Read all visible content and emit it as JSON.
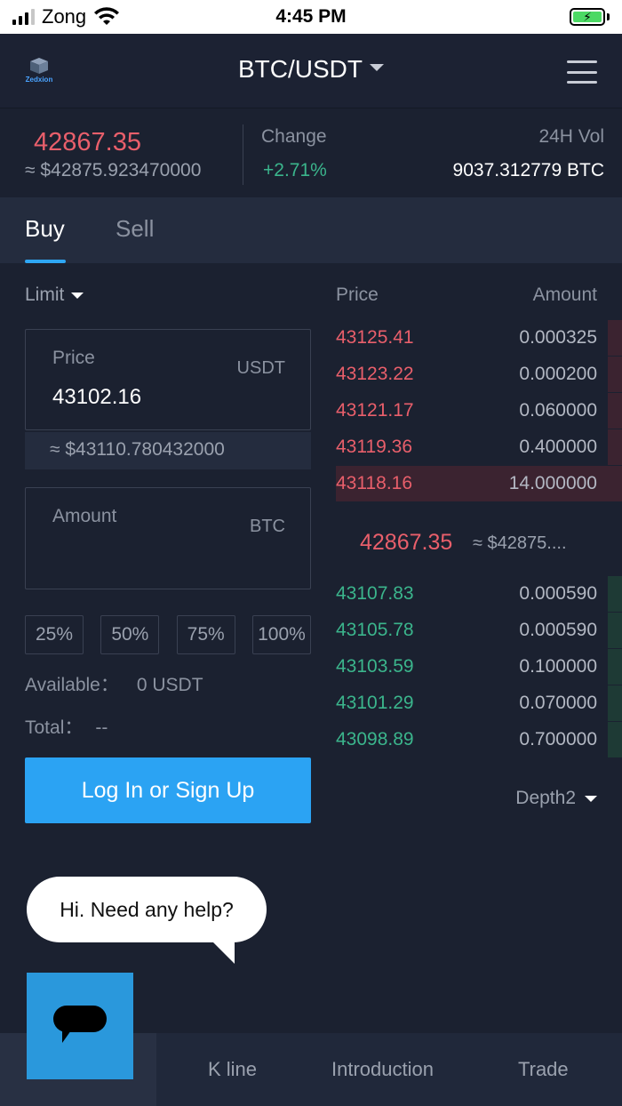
{
  "status_bar": {
    "carrier": "Zong",
    "time": "4:45 PM"
  },
  "header": {
    "logo_text": "Zedxion",
    "pair": "BTC/USDT"
  },
  "ticker": {
    "last_price": "42867.35",
    "last_price_usd": "≈ $42875.923470000",
    "change_label": "Change",
    "change_value": "+2.71%",
    "vol_label": "24H Vol",
    "vol_value": "9037.312779 BTC"
  },
  "tabs": {
    "buy": "Buy",
    "sell": "Sell"
  },
  "order_form": {
    "order_type": "Limit",
    "price_label": "Price",
    "price_unit": "USDT",
    "price_value": "43102.16",
    "price_usd": "≈ $43110.780432000",
    "amount_label": "Amount",
    "amount_unit": "BTC",
    "amount_value": "",
    "percent_buttons": [
      "25%",
      "50%",
      "75%",
      "100%"
    ],
    "available_label": "Available：",
    "available_value": "0 USDT",
    "total_label": "Total：",
    "total_value": "--",
    "login_button": "Log In or Sign Up"
  },
  "order_book": {
    "price_header": "Price",
    "amount_header": "Amount",
    "asks": [
      {
        "price": "43125.41",
        "amount": "0.000325",
        "depth": 0.05
      },
      {
        "price": "43123.22",
        "amount": "0.000200",
        "depth": 0.05
      },
      {
        "price": "43121.17",
        "amount": "0.060000",
        "depth": 0.05
      },
      {
        "price": "43119.36",
        "amount": "0.400000",
        "depth": 0.05
      },
      {
        "price": "43118.16",
        "amount": "14.000000",
        "depth": 1.0
      }
    ],
    "mid_price": "42867.35",
    "mid_usd": "≈ $42875....",
    "bids": [
      {
        "price": "43107.83",
        "amount": "0.000590",
        "depth": 0.05
      },
      {
        "price": "43105.78",
        "amount": "0.000590",
        "depth": 0.05
      },
      {
        "price": "43103.59",
        "amount": "0.100000",
        "depth": 0.05
      },
      {
        "price": "43101.29",
        "amount": "0.070000",
        "depth": 0.05
      },
      {
        "price": "43098.89",
        "amount": "0.700000",
        "depth": 0.05
      }
    ],
    "depth_select": "Depth2"
  },
  "chat": {
    "bubble_text": "Hi. Need any help?"
  },
  "bottom_nav": {
    "kline": "K line",
    "introduction": "Introduction",
    "trade": "Trade"
  },
  "colors": {
    "ask": "#e95f6b",
    "bid": "#3bb58c",
    "accent": "#2ba3f3",
    "background": "#1b2130"
  }
}
